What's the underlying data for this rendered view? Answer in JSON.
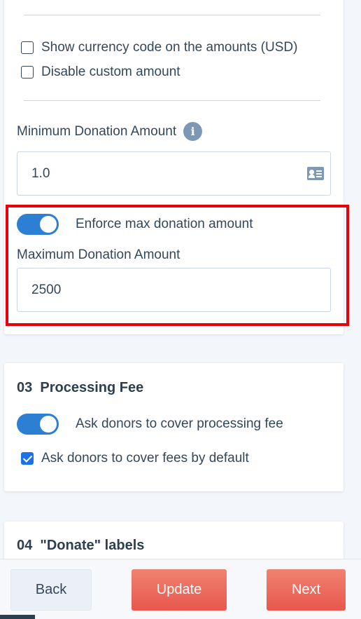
{
  "section_options": {
    "show_currency_code_label": "Show currency code on the amounts (USD)",
    "disable_custom_amount_label": "Disable custom amount",
    "show_currency_code_checked": false,
    "disable_custom_amount_checked": false,
    "minimum_label": "Minimum Donation Amount",
    "minimum_value": "1.0",
    "enforce_max_label": "Enforce max donation amount",
    "enforce_max_enabled": true,
    "maximum_label": "Maximum Donation Amount",
    "maximum_value": "2500"
  },
  "processing_fee": {
    "number": "03",
    "title": "Processing Fee",
    "ask_cover_fee_label": "Ask donors to cover processing fee",
    "ask_cover_fee_enabled": true,
    "cover_by_default_label": "Ask donors to cover fees by default",
    "cover_by_default_checked": true
  },
  "donate_labels": {
    "number": "04",
    "title": "\"Donate\" labels"
  },
  "footer": {
    "back_label": "Back",
    "update_label": "Update",
    "next_label": "Next"
  },
  "colors": {
    "toggle_on": "#2d7fd3",
    "highlight": "#e8000b",
    "primary_button": "#e8574d"
  },
  "icons": {
    "info": "info-icon",
    "contact_card": "contact-card-icon"
  }
}
